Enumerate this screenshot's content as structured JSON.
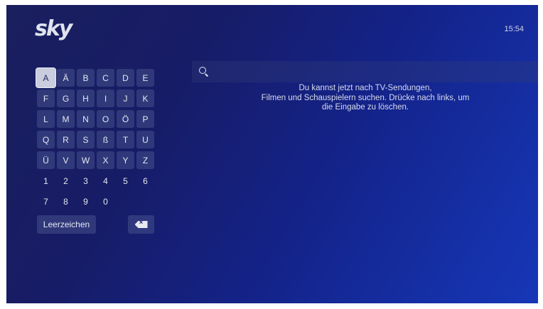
{
  "app": {
    "logo_text": "sky",
    "clock": "15:54"
  },
  "keyboard": {
    "rows": [
      [
        "A",
        "Ä",
        "B",
        "C",
        "D",
        "E"
      ],
      [
        "F",
        "G",
        "H",
        "I",
        "J",
        "K"
      ],
      [
        "L",
        "M",
        "N",
        "O",
        "Ö",
        "P"
      ],
      [
        "Q",
        "R",
        "S",
        "ß",
        "T",
        "U"
      ],
      [
        "Ü",
        "V",
        "W",
        "X",
        "Y",
        "Z"
      ],
      [
        "1",
        "2",
        "3",
        "4",
        "5",
        "6"
      ],
      [
        "7",
        "8",
        "9",
        "0"
      ]
    ],
    "selected_key": "A",
    "space_label": "Leerzeichen",
    "backspace_icon": "backspace-icon"
  },
  "search": {
    "icon": "search-icon",
    "query": "",
    "hint": "Du kannst jetzt nach TV-Sendungen, Filmen und Schauspielern suchen. Drücke nach links, um die Eingabe zu löschen.",
    "hint_lines": [
      "Du kannst jetzt nach TV-Sendungen,",
      "Filmen und Schauspielern suchen. Drücke nach links, um",
      "die Eingabe zu löschen."
    ]
  }
}
